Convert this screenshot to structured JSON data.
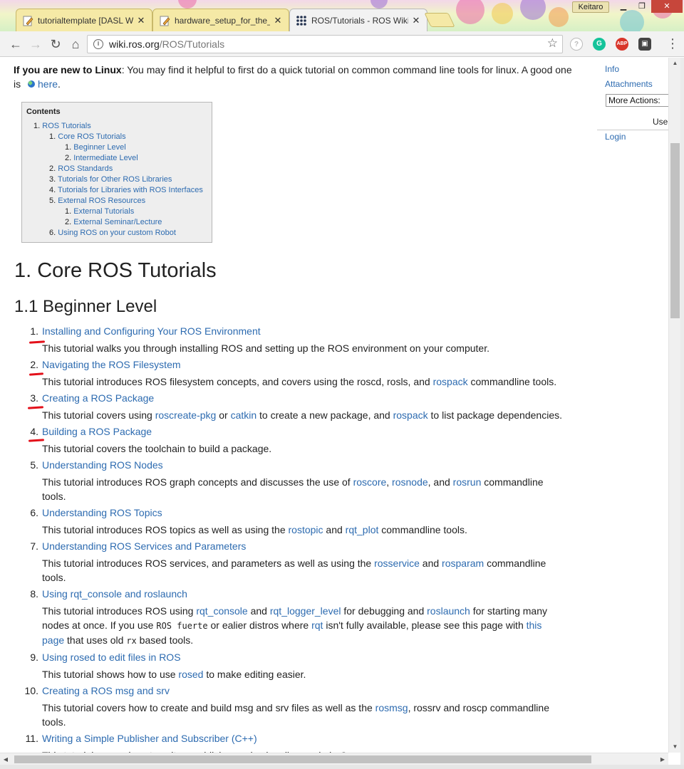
{
  "browser": {
    "tabs": [
      {
        "title": "tutorialtemplate [DASL W",
        "close": "✕",
        "favicon": "pencil-page-icon"
      },
      {
        "title": "hardware_setup_for_the_",
        "close": "✕",
        "favicon": "pencil-page-icon"
      },
      {
        "title": "ROS/Tutorials - ROS Wiki",
        "close": "✕",
        "favicon": "ros-dots-icon"
      }
    ],
    "profile_name": "Keitaro",
    "window_buttons": {
      "minimize": "▁",
      "maximize": "❐",
      "close": "✕"
    },
    "url_host": "wiki.ros.org",
    "url_path": "/ROS/Tutorials",
    "nav_icons": {
      "back": "←",
      "forward": "→",
      "reload": "↻",
      "home": "⌂",
      "star": "☆",
      "menu": "⋮"
    },
    "ext_labels": {
      "help": "?",
      "grammarly": "G",
      "abp": "ABP",
      "other": "▣"
    }
  },
  "intro": {
    "bold": "If you are new to Linux",
    "text": ": You may find it helpful to first do a quick tutorial on common command line tools for linux. A good one is",
    "link": "here",
    "end": "."
  },
  "sidebar": {
    "info": "Info",
    "attachments": "Attachments",
    "more_actions": "More Actions:",
    "user": "Use",
    "login": "Login"
  },
  "toc": {
    "title": "Contents",
    "rows": [
      {
        "num": "1.",
        "label": "ROS Tutorials"
      },
      {
        "num": "1.",
        "label": "Core ROS Tutorials"
      },
      {
        "num": "1.",
        "label": "Beginner Level"
      },
      {
        "num": "2.",
        "label": "Intermediate Level"
      },
      {
        "num": "2.",
        "label": "ROS Standards"
      },
      {
        "num": "3.",
        "label": "Tutorials for Other ROS Libraries"
      },
      {
        "num": "4.",
        "label": "Tutorials for Libraries with ROS Interfaces"
      },
      {
        "num": "5.",
        "label": "External ROS Resources"
      },
      {
        "num": "1.",
        "label": "External Tutorials"
      },
      {
        "num": "2.",
        "label": "External Seminar/Lecture"
      },
      {
        "num": "6.",
        "label": "Using ROS on your custom Robot"
      }
    ]
  },
  "headings": {
    "h1": "1. Core ROS Tutorials",
    "h2": "1.1 Beginner Level"
  },
  "tutorials": [
    {
      "num": "1.",
      "title": "Installing and Configuring Your ROS Environment",
      "desc": [
        {
          "t": "This tutorial walks you through installing ROS and setting up the ROS environment on your computer."
        }
      ]
    },
    {
      "num": "2.",
      "title": "Navigating the ROS Filesystem",
      "desc": [
        {
          "t": "This tutorial introduces ROS filesystem concepts, and covers using the roscd, rosls, and "
        },
        {
          "l": "rospack"
        },
        {
          "t": " commandline tools."
        }
      ]
    },
    {
      "num": "3.",
      "title": "Creating a ROS Package",
      "desc": [
        {
          "t": "This tutorial covers using "
        },
        {
          "l": "roscreate-pkg"
        },
        {
          "t": " or "
        },
        {
          "l": "catkin"
        },
        {
          "t": " to create a new package, and "
        },
        {
          "l": "rospack"
        },
        {
          "t": " to list package dependencies."
        }
      ]
    },
    {
      "num": "4.",
      "title": "Building a ROS Package",
      "desc": [
        {
          "t": "This tutorial covers the toolchain to build a package."
        }
      ]
    },
    {
      "num": "5.",
      "title": "Understanding ROS Nodes",
      "desc": [
        {
          "t": "This tutorial introduces ROS graph concepts and discusses the use of "
        },
        {
          "l": "roscore"
        },
        {
          "t": ", "
        },
        {
          "l": "rosnode"
        },
        {
          "t": ", and "
        },
        {
          "l": "rosrun"
        },
        {
          "t": " commandline tools."
        }
      ]
    },
    {
      "num": "6.",
      "title": "Understanding ROS Topics",
      "desc": [
        {
          "t": "This tutorial introduces ROS topics as well as using the "
        },
        {
          "l": "rostopic"
        },
        {
          "t": " and "
        },
        {
          "l": "rqt_plot"
        },
        {
          "t": " commandline tools."
        }
      ]
    },
    {
      "num": "7.",
      "title": "Understanding ROS Services and Parameters",
      "desc": [
        {
          "t": "This tutorial introduces ROS services, and parameters as well as using the "
        },
        {
          "l": "rosservice"
        },
        {
          "t": " and "
        },
        {
          "l": "rosparam"
        },
        {
          "t": " commandline tools."
        }
      ]
    },
    {
      "num": "8.",
      "title": "Using rqt_console and roslaunch",
      "desc": [
        {
          "t": "This tutorial introduces ROS using "
        },
        {
          "l": "rqt_console"
        },
        {
          "t": " and "
        },
        {
          "l": "rqt_logger_level"
        },
        {
          "t": " for debugging and "
        },
        {
          "l": "roslaunch"
        },
        {
          "t": " for starting many nodes at once. If you use "
        },
        {
          "c": "ROS fuerte"
        },
        {
          "t": " or ealier distros where "
        },
        {
          "l": "rqt"
        },
        {
          "t": " isn't fully available, please see this page with "
        },
        {
          "l": "this page"
        },
        {
          "t": " that uses old "
        },
        {
          "c": "rx"
        },
        {
          "t": " based tools."
        }
      ]
    },
    {
      "num": "9.",
      "title": "Using rosed to edit files in ROS",
      "desc": [
        {
          "t": "This tutorial shows how to use "
        },
        {
          "l": "rosed"
        },
        {
          "t": " to make editing easier."
        }
      ]
    },
    {
      "num": "10.",
      "title": "Creating a ROS msg and srv",
      "desc": [
        {
          "t": "This tutorial covers how to create and build msg and srv files as well as the "
        },
        {
          "l": "rosmsg"
        },
        {
          "t": ", rossrv and roscp commandline tools."
        }
      ]
    },
    {
      "num": "11.",
      "title": "Writing a Simple Publisher and Subscriber (C++)",
      "desc": [
        {
          "t": "This tutorial covers how to write a publisher and subscriber node in C++."
        }
      ]
    }
  ],
  "colors": {
    "link": "#2d6bb0",
    "annotation": "#e3101a",
    "toc_bg": "#eeeeee"
  }
}
